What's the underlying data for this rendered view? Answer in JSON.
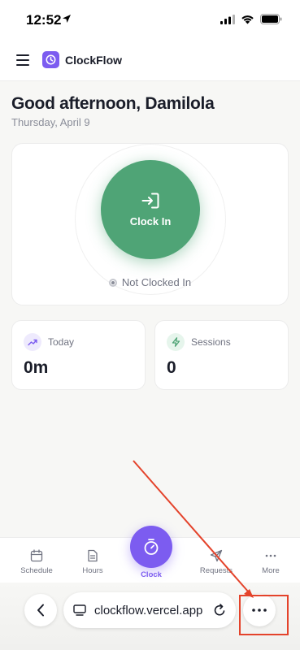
{
  "status_bar": {
    "time": "12:52"
  },
  "header": {
    "app_name": "ClockFlow"
  },
  "greeting": {
    "title": "Good afternoon, Damilola",
    "date": "Thursday, April 9"
  },
  "clock_card": {
    "button_label": "Clock In",
    "status_text": "Not Clocked In"
  },
  "stats": {
    "today": {
      "label": "Today",
      "value": "0m"
    },
    "sessions": {
      "label": "Sessions",
      "value": "0"
    }
  },
  "bottom_nav": {
    "schedule": "Schedule",
    "hours": "Hours",
    "clock": "Clock",
    "requests": "Requests",
    "more": "More"
  },
  "browser": {
    "url": "clockflow.vercel.app"
  },
  "colors": {
    "accent_purple": "#7c5cf0",
    "clock_in_green": "#4fa476",
    "annotation_red": "#e4432b"
  },
  "icons": {
    "status_location": "location-arrow-icon",
    "signal": "signal-icon",
    "wifi": "wifi-icon",
    "battery": "battery-icon",
    "menu": "hamburger-icon",
    "brand": "clock-icon",
    "clock_in": "sign-in-icon",
    "today": "trending-up-icon",
    "sessions": "lightning-icon",
    "schedule": "calendar-icon",
    "hours": "document-icon",
    "clock_fab": "stopwatch-icon",
    "requests": "send-icon",
    "more": "ellipsis-icon",
    "back": "chevron-left-icon",
    "tabs": "tabs-icon",
    "reload": "reload-icon",
    "browser_more": "ellipsis-icon"
  }
}
